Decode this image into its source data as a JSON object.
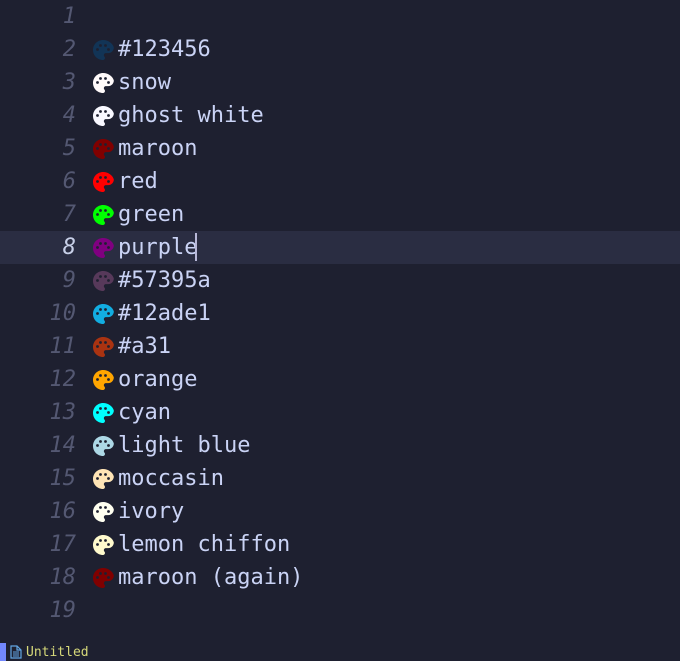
{
  "editor": {
    "active_line": 8,
    "lines": [
      {
        "num": 1,
        "text": "",
        "color": null
      },
      {
        "num": 2,
        "text": "#123456",
        "color": "#123456"
      },
      {
        "num": 3,
        "text": "snow",
        "color": "#fffafa"
      },
      {
        "num": 4,
        "text": "ghost white",
        "color": "#f8f8ff"
      },
      {
        "num": 5,
        "text": "maroon",
        "color": "#800000"
      },
      {
        "num": 6,
        "text": "red",
        "color": "#ff0000"
      },
      {
        "num": 7,
        "text": "green",
        "color": "#00ff00"
      },
      {
        "num": 8,
        "text": "purple",
        "color": "#800080"
      },
      {
        "num": 9,
        "text": "#57395a",
        "color": "#57395a"
      },
      {
        "num": 10,
        "text": "#12ade1",
        "color": "#12ade1"
      },
      {
        "num": 11,
        "text": "#a31",
        "color": "#aa3311"
      },
      {
        "num": 12,
        "text": "orange",
        "color": "#ffa500"
      },
      {
        "num": 13,
        "text": "cyan",
        "color": "#00ffff"
      },
      {
        "num": 14,
        "text": "light blue",
        "color": "#add8e6"
      },
      {
        "num": 15,
        "text": "moccasin",
        "color": "#ffe4b5"
      },
      {
        "num": 16,
        "text": "ivory",
        "color": "#fffff0"
      },
      {
        "num": 17,
        "text": "lemon chiffon",
        "color": "#fffacd"
      },
      {
        "num": 18,
        "text": "maroon (again)",
        "color": "#800000"
      },
      {
        "num": 19,
        "text": "",
        "color": null
      }
    ]
  },
  "status": {
    "filename": "Untitled"
  }
}
